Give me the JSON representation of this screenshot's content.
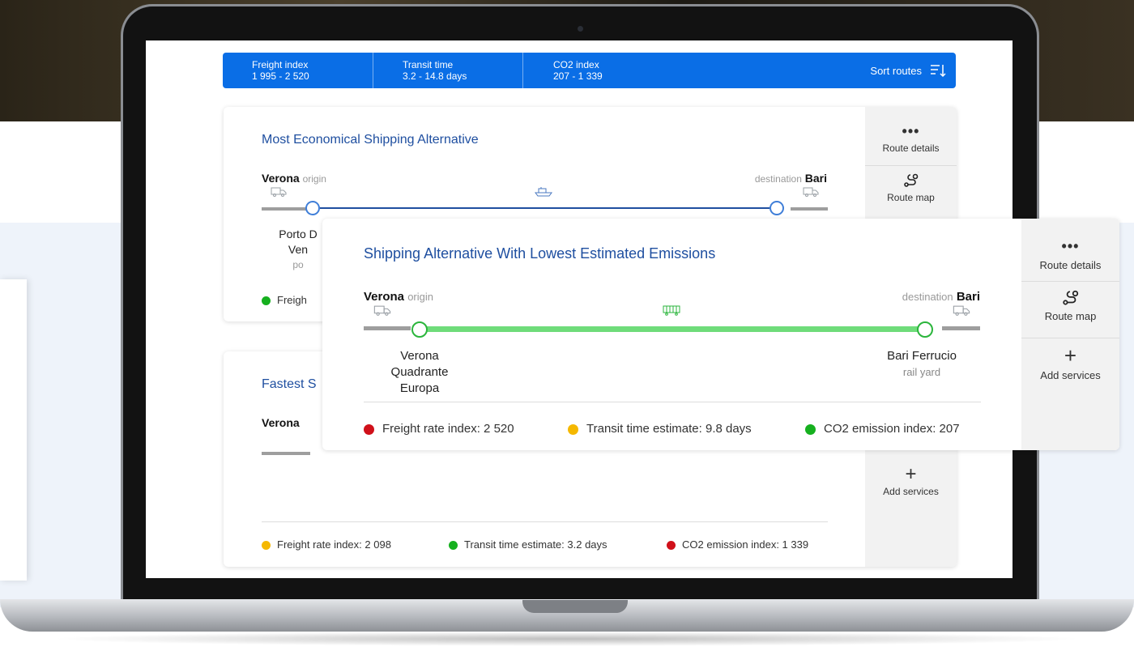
{
  "topbar": {
    "freight_label": "Freight index",
    "freight_value": "1 995 - 2 520",
    "transit_label": "Transit time",
    "transit_value": "3.2 - 14.8 days",
    "co2_label": "CO2 index",
    "co2_value": "207 - 1 339",
    "sort_label": "Sort routes"
  },
  "card1": {
    "title": "Most Economical Shipping Alternative",
    "origin_city": "Verona",
    "origin_tag": "origin",
    "dest_tag": "destination",
    "dest_city": "Bari",
    "stop_line1": "Porto D",
    "stop_line2": "Ven",
    "stop_line3": "po",
    "metric_partial": "Freigh",
    "side": {
      "details": "Route details",
      "map": "Route map"
    }
  },
  "card2": {
    "title_partial": "Fastest S",
    "origin_city": "Verona",
    "metrics": [
      {
        "label": "Freight rate index: 2 098",
        "color": "#f5b800"
      },
      {
        "label": "Transit time estimate: 3.2 days",
        "color": "#16b01f"
      },
      {
        "label": "CO2 emission index: 1 339",
        "color": "#d0101a"
      }
    ],
    "side": {
      "services": "Add services"
    }
  },
  "card3": {
    "title": "Shipping Alternative With Lowest Estimated Emissions",
    "origin_city": "Verona",
    "origin_tag": "origin",
    "dest_tag": "destination",
    "dest_city": "Bari",
    "origin_stop_l1": "Verona",
    "origin_stop_l2": "Quadrante",
    "origin_stop_l3": "Europa",
    "dest_stop_l1": "Bari Ferrucio",
    "dest_stop_l2": "rail yard",
    "metrics": [
      {
        "label": "Freight rate index: 2 520",
        "color": "#d0101a"
      },
      {
        "label": "Transit time estimate: 9.8 days",
        "color": "#f5b800"
      },
      {
        "label": "CO2 emission index: 207",
        "color": "#16b01f"
      }
    ],
    "side": {
      "details": "Route details",
      "map": "Route map",
      "services": "Add services"
    }
  },
  "colors": {
    "accent": "#0a6ee6",
    "title": "#1f4fa0",
    "rail": "#6fdc7a",
    "rail_node": "#2bb53c",
    "leg_gray": "#9e9e9e"
  }
}
